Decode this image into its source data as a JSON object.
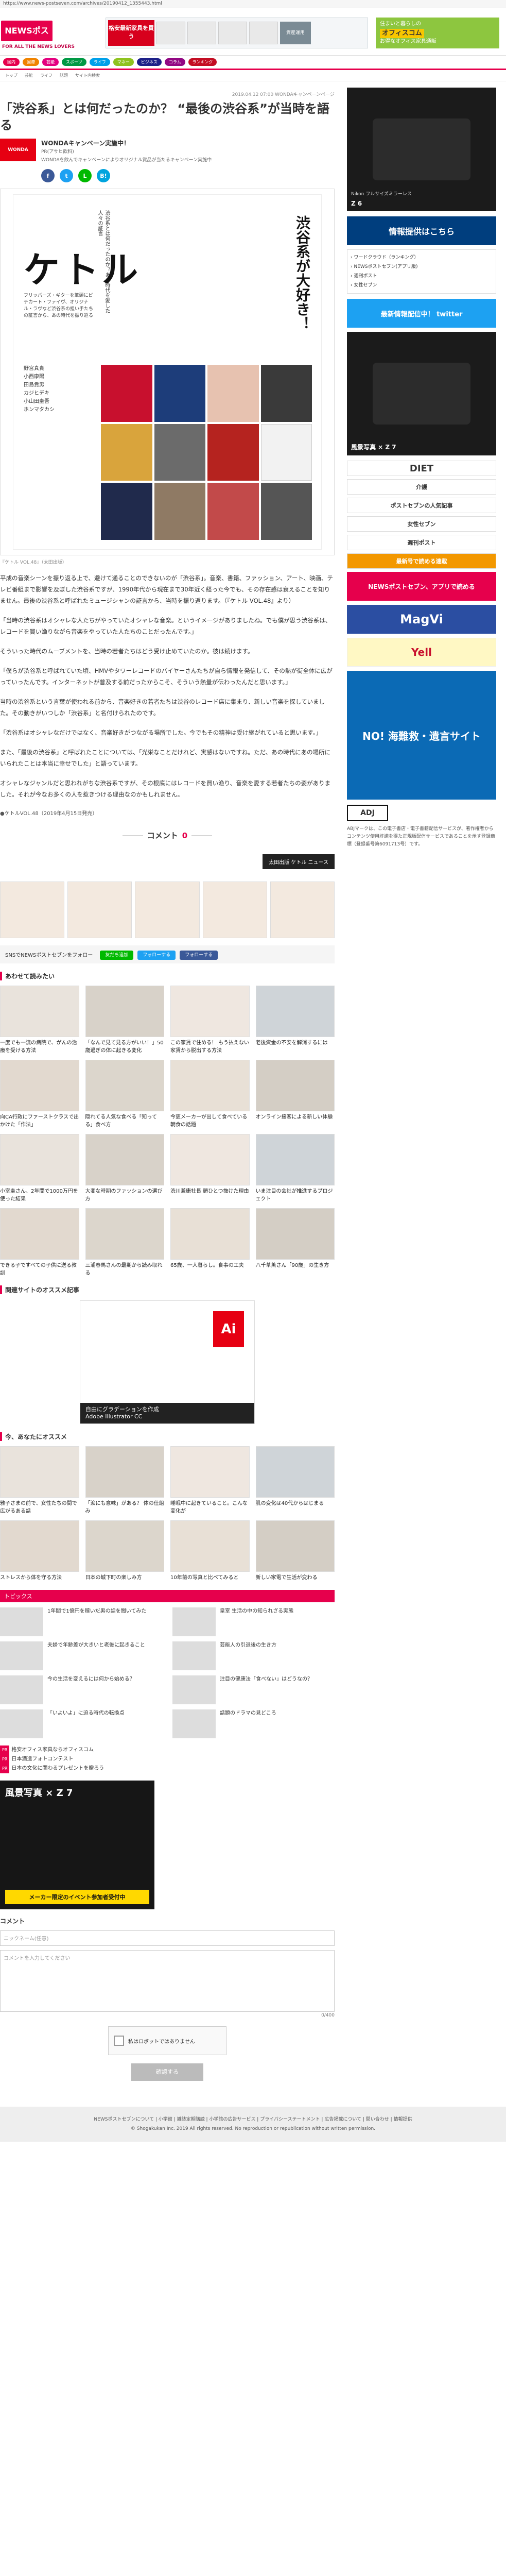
{
  "browser": {
    "url": "https://www.news-postseven.com/archives/20190412_1355443.html"
  },
  "header": {
    "logo": "NEWSポストセブン",
    "tagline": "FOR ALL THE NEWS LOVERS",
    "ad_top": {
      "red_text": "格安最新家具を買う",
      "finance_label": "資産運用"
    },
    "ad_right": {
      "line1": "住まいと暮らしの",
      "big": "オフィスコム",
      "line2": "お得なオフィス家具通販"
    }
  },
  "nav": {
    "items": [
      {
        "label": "国内",
        "color": "#e6004c"
      },
      {
        "label": "国際",
        "color": "#f08300"
      },
      {
        "label": "芸能",
        "color": "#e4007f"
      },
      {
        "label": "スポーツ",
        "color": "#009944"
      },
      {
        "label": "ライフ",
        "color": "#00a0e9"
      },
      {
        "label": "マネー",
        "color": "#8fc31f"
      },
      {
        "label": "ビジネス",
        "color": "#1d2088"
      },
      {
        "label": "コラム",
        "color": "#920783"
      },
      {
        "label": "ランキング",
        "color": "#c30d23"
      }
    ],
    "subnav": [
      "トップ",
      "芸能",
      "ライフ",
      "話題",
      "サイト内検索"
    ]
  },
  "article": {
    "date": "2019.04.12 07:00",
    "source": "WONDAキャンペーンページ",
    "title": "「渋谷系」とは何だったのか？ “最後の渋谷系”が当時を語る",
    "author_logo": "WONDA",
    "author_name": "WONDAキャンペーン実施中！",
    "author_sub": "PR(アサヒ飲料)",
    "author_desc": "WONDAを飲んでキャンペーンによりオリジナル賞品が当たるキャンペーン実施中",
    "cover": {
      "title": "ケトル",
      "right_text": "渋谷系が大好き！",
      "small_text": "渋谷系とは何だったのか？あの時代を愛した人々の証言",
      "desc": "フリッパーズ・ギターを筆頭にピチカート・ファイヴ、オリジナル・ラヴなど渋谷系の担い手たちの証言から、あの時代を振り返る",
      "list": [
        "野宮真貴",
        "小西康陽",
        "田島貴男",
        "カジヒデキ",
        "小山田圭吾",
        "ホンマタカシ"
      ]
    },
    "caption": "『ケトル VOL.48』（太田出版）",
    "paragraphs": [
      "平成の音楽シーンを振り返る上で、避けて通ることのできないのが「渋谷系」。音楽、書籍、ファッション、アート、映画、テレビ番組まで影響を及ぼした渋谷系ですが、1990年代から現在まで30年近く経った今でも、その存在感は衰えることを知りません。最後の渋谷系と呼ばれたミュージシャンの証言から、当時を振り返ります。（『ケトル VOL.48』より）",
      "「当時の渋谷系はオシャレな人たちがやっていたオシャレな音楽。というイメージがありましたね。でも僕が思う渋谷系は、レコードを買い漁りながら音楽をやっていた人たちのことだったんです。」",
      "そういった時代のムーブメントを、当時の若者たちはどう受け止めていたのか。彼は続けます。",
      "「僕らが渋谷系と呼ばれていた頃、HMVやタワーレコードのバイヤーさんたちが自ら情報を発信して、その熱が街全体に広がっていったんです。インターネットが普及する前だったからこそ、そういう熱量が伝わったんだと思います。」",
      "当時の渋谷系という言葉が使われる前から、音楽好きの若者たちは渋谷のレコード店に集まり、新しい音楽を探していました。その動きがいつしか「渋谷系」と名付けられたのです。",
      "「渋谷系はオシャレなだけではなく、音楽好きがつながる場所でした。今でもその精神は受け継がれていると思います。」",
      "また、「最後の渋谷系」と呼ばれたことについては、「光栄なことだけれど、実感はないですね。ただ、あの時代にあの場所にいられたことは本当に幸せでした」と語っています。",
      "オシャレなジャンルだと思われがちな渋谷系ですが、その根底にはレコードを買い漁り、音楽を愛する若者たちの姿がありました。それが今なお多くの人を惹きつける理由なのかもしれません。"
    ],
    "source_note": "●ケトルVOL.48（2019年4月15日発売）",
    "comments_label": "コメント",
    "comments_count": "0",
    "related_button": "太田出版 ケトル ニュース"
  },
  "sns": {
    "label": "SNSでNEWSポストセブンをフォロー",
    "buttons": [
      {
        "label": "友だち追加",
        "color": "#00b900"
      },
      {
        "label": "フォローする",
        "color": "#1da1f2"
      },
      {
        "label": "フォローする",
        "color": "#3b5998"
      }
    ]
  },
  "recommend_title": "あわせて読みたい",
  "recommend": [
    "一度でも一流の病院で、がんの治療を受ける方法",
    "「なんで見て見る方がいい！」50歳過ぎの体に起きる変化",
    "この家賃で住める！ もう払えない家賃から脱出する方法",
    "老後資金の不安を解消するには",
    "向CA行政にファーストクラスで出かけた「作法」",
    "隠れてる人気な食べる「知ってる」食べ方",
    "今更メーカーが出して食べている朝食の話題",
    "オンライン接客による新しい体験",
    "小室圭さん、2年間で1000万円を使った結果",
    "大変な時期のファッションの選び方",
    "渋川兼康社長 頭ひとつ抜けた理由",
    "いま注目の会社が推進するプロジェクト",
    "できる子ですべての子供に送る教訓",
    "三浦春馬さんの最期から読み取れる",
    "65歳、一人暮らし。食事の工夫",
    "八千草薫さん「90歳」の生き方"
  ],
  "related_sites_title": "関連サイトのオススメ記事",
  "ad_block": {
    "title": "自由にグラデーションを作成",
    "sub": "Adobe Illustrator CC",
    "logo": "Ai"
  },
  "you_might_like_title": "今、あなたにオススメ",
  "you_might_like": [
    "雅子さまの前で、女性たちの間で広がるある話",
    "「涙にも意味」がある？ 体の仕組み",
    "睡眠中に起きていること。こんな変化が",
    "肌の変化は40代からはじまる",
    "ストレスから体を守る方法",
    "日本の城下町の楽しみ方",
    "10年前の写真と比べてみると",
    "新しい家電で生活が変わる"
  ],
  "trends_title": "トピックス",
  "topics": [
    "1年間で1億円を稼いだ男の話を聞いてみた",
    "皇室 生活の中の知られざる実態",
    "夫婦で年齢差が大きいと老後に起きること",
    "芸能人の引退後の生き方",
    "今の生活を変えるには何から始める？",
    "注目の健康法「食べない」はどうなの？",
    "「いよいよ」に迫る時代の転換点",
    "話題のドラマの見どころ"
  ],
  "promo": [
    {
      "tag": "PR",
      "text": "格安オフィス家具ならオフィスコム"
    },
    {
      "tag": "PR",
      "text": "日本酒造フォトコンテスト"
    },
    {
      "tag": "PR",
      "text": "日本の文化に関わるプレゼントを贈ろう"
    }
  ],
  "z7_ad": {
    "title": "風景写真 × Z 7",
    "cta": "メーカー限定のイベント参加者受付中"
  },
  "comment_form": {
    "title": "コメント",
    "name_placeholder": "ニックネーム(任意)",
    "text_placeholder": "コメントを入力してください",
    "count": "0/400",
    "captcha": "私はロボットではありません",
    "submit": "確認する"
  },
  "footer": {
    "links": "NEWSポストセブンについて | 小学館 | 雑誌定期購読 | 小学館の広告サービス | プライバシーステートメント | 広告掲載について | 問い合わせ | 情報提供",
    "copyright": "© Shogakukan Inc. 2019 All rights reserved. No reproduction or republication without written permission."
  },
  "sidebar": {
    "ad1": {
      "label": "Z 6",
      "sub": "Nikon フルサイズミラーレス"
    },
    "info": {
      "title": "情報提供はこちら",
      "sub": "ご意見・ご感想"
    },
    "links": [
      "ワードクラウド（ランキング）",
      "NEWSポストセブン(アプリ版)",
      "週刊ポスト",
      "女性セブン"
    ],
    "twitter": "最新情報配信中！ twitter",
    "z7": "風景写真 × Z 7",
    "diet": "DIET",
    "kaigo": "介護",
    "ranks": [
      "ポストセブンの人気記事",
      "女性セブン",
      "週刊ポスト"
    ],
    "magazine": "最新号で読める連載",
    "mag_ad": "NEWSポストセブン、アプリで読める",
    "magvi": "MagVi",
    "yell": "Yell",
    "no": "NO! 海難救・遺言サイト",
    "adj": "ADJ",
    "adj_text": "ABJマークは、この電子書店・電子書籍配信サービスが、著作権者からコンテンツ使用許諾を得た正規版配信サービスであることを示す登録商標（登録番号第6091713号）です。"
  }
}
